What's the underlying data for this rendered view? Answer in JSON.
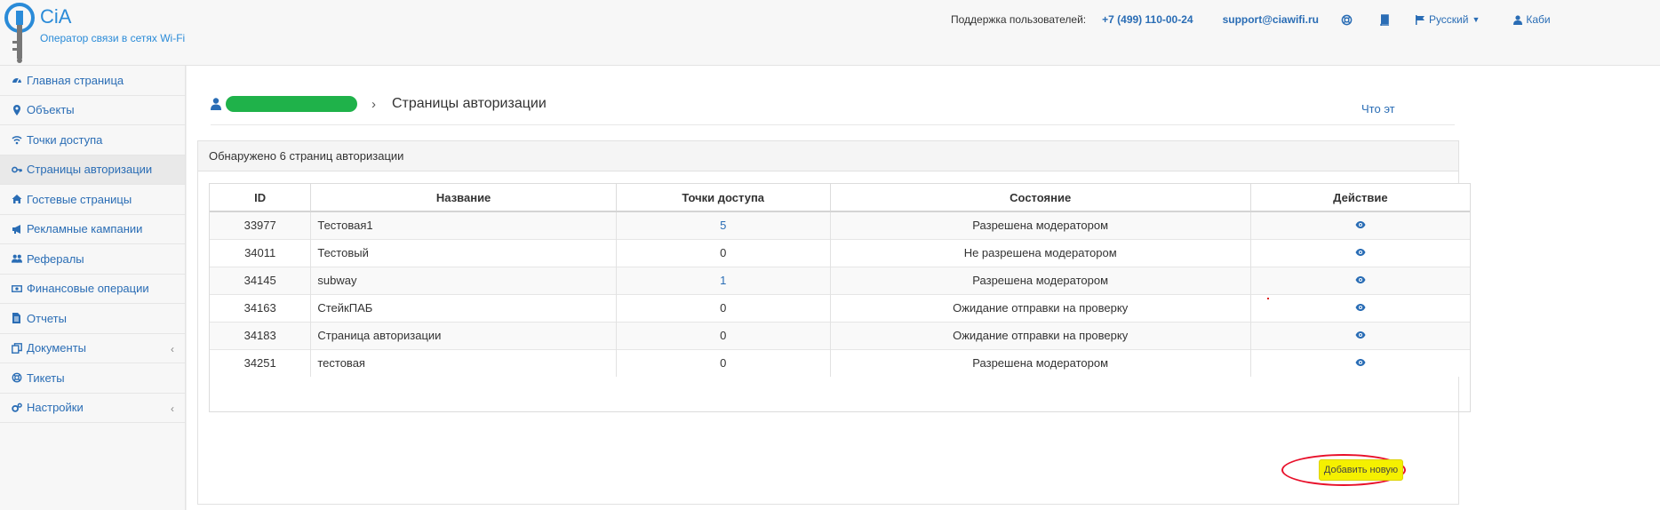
{
  "brand": {
    "name": "CiA",
    "tagline": "Оператор связи в сетях Wi-Fi"
  },
  "topnav": {
    "support_label": "Поддержка пользователей:",
    "phone": "+7 (499) 110-00-24",
    "email": "support@ciawifi.ru",
    "language": "Русский",
    "cabinet": "Каби"
  },
  "sidebar": {
    "items": [
      {
        "label": "Главная страница",
        "icon": "dashboard-icon"
      },
      {
        "label": "Объекты",
        "icon": "map-marker-icon"
      },
      {
        "label": "Точки доступа",
        "icon": "wifi-icon"
      },
      {
        "label": "Страницы авторизации",
        "icon": "key-icon"
      },
      {
        "label": "Гостевые страницы",
        "icon": "home-icon"
      },
      {
        "label": "Рекламные кампании",
        "icon": "bullhorn-icon"
      },
      {
        "label": "Рефералы",
        "icon": "users-icon"
      },
      {
        "label": "Финансовые операции",
        "icon": "money-icon"
      },
      {
        "label": "Отчеты",
        "icon": "file-icon"
      },
      {
        "label": "Документы",
        "icon": "documents-icon"
      },
      {
        "label": "Тикеты",
        "icon": "lifebuoy-icon"
      },
      {
        "label": "Настройки",
        "icon": "cogs-icon"
      }
    ]
  },
  "breadcrumb": {
    "current": "Страницы авторизации",
    "separator": "›"
  },
  "help_link": "Что эт",
  "panel": {
    "heading": "Обнаружено 6 страниц авторизации",
    "columns": [
      "ID",
      "Название",
      "Точки доступа",
      "Состояние",
      "Действие"
    ],
    "rows": [
      {
        "id": "33977",
        "name": "Тестовая1",
        "points": "5",
        "status": "Разрешена модератором"
      },
      {
        "id": "34011",
        "name": "Тестовый",
        "points": "0",
        "status": "Не разрешена модератором"
      },
      {
        "id": "34145",
        "name": "subway",
        "points": "1",
        "status": "Разрешена модератором"
      },
      {
        "id": "34163",
        "name": "СтейкПАБ",
        "points": "0",
        "status": "Ожидание отправки на проверку"
      },
      {
        "id": "34183",
        "name": "Страница авторизации",
        "points": "0",
        "status": "Ожидание отправки на проверку"
      },
      {
        "id": "34251",
        "name": "тестовая",
        "points": "0",
        "status": "Разрешена модератором"
      }
    ],
    "add_button": "Добавить новую"
  },
  "colors": {
    "link": "#2a6db5",
    "brand": "#2a8bd8",
    "redaction": "#1fb24a",
    "highlight_button": "#f5f000",
    "annotation_ellipse": "#e8102a"
  }
}
